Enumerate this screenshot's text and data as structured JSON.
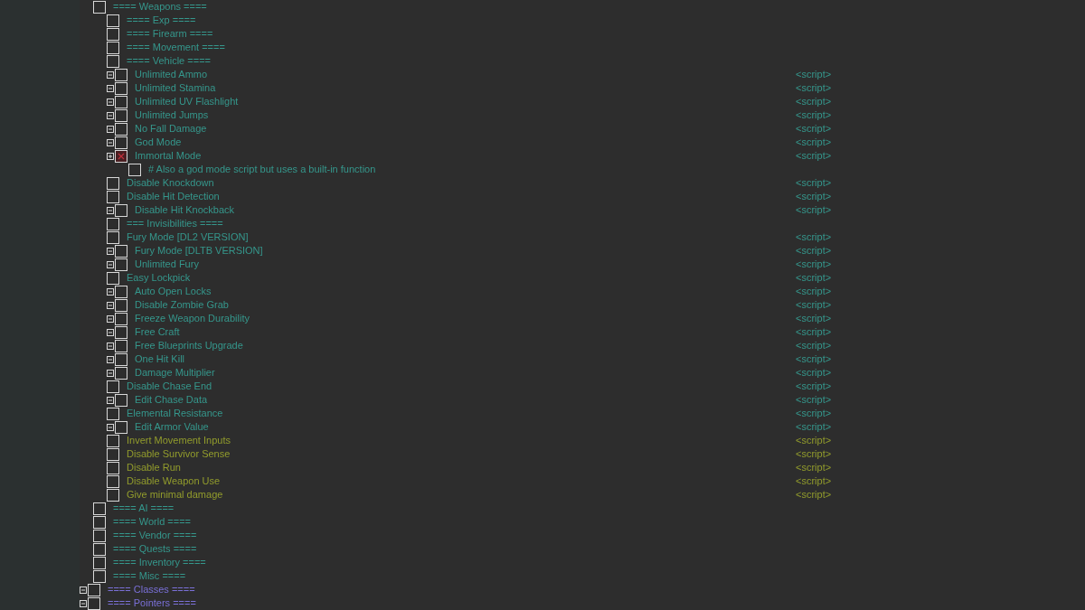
{
  "table": {
    "entries": [
      {
        "children": [
          {
            "label": "==== Weapons ====",
            "color": "#35978c",
            "checked": false,
            "children": [
              {
                "label": "==== Exp ====",
                "color": "#35978c",
                "checked": false
              },
              {
                "label": "==== Firearm ====",
                "color": "#35978c",
                "checked": false
              },
              {
                "label": "==== Movement ====",
                "color": "#35978c",
                "checked": false
              },
              {
                "label": "==== Vehicle ====",
                "color": "#35978c",
                "checked": false
              },
              {
                "label": "Unlimited Ammo",
                "color": "#35978c",
                "checked": false,
                "expanded": true,
                "value": "<script>"
              },
              {
                "label": "Unlimited Stamina",
                "color": "#35978c",
                "checked": false,
                "expanded": true,
                "value": "<script>"
              },
              {
                "label": "Unlimited UV Flashlight",
                "color": "#35978c",
                "checked": false,
                "expanded": true,
                "value": "<script>"
              },
              {
                "label": "Unlimited Jumps",
                "color": "#35978c",
                "checked": false,
                "expanded": true,
                "value": "<script>"
              },
              {
                "label": "No Fall Damage",
                "color": "#35978c",
                "checked": false,
                "expanded": true,
                "value": "<script>"
              },
              {
                "label": "God Mode",
                "color": "#35978c",
                "checked": false,
                "expanded": true,
                "value": "<script>"
              },
              {
                "label": "Immortal Mode",
                "color": "#35978c",
                "checked": true,
                "expanded": false,
                "value": "<script>",
                "children": [
                  {
                    "label": "# Also a god mode script but uses a built-in function",
                    "color": "#35978c",
                    "checked": false
                  }
                ]
              },
              {
                "label": "Disable Knockdown",
                "color": "#35978c",
                "checked": false,
                "value": "<script>"
              },
              {
                "label": "Disable Hit Detection",
                "color": "#35978c",
                "checked": false,
                "value": "<script>"
              },
              {
                "label": "Disable Hit Knockback",
                "color": "#35978c",
                "checked": false,
                "expanded": true,
                "value": "<script>"
              },
              {
                "label": "=== Invisibilities ====",
                "color": "#35978c",
                "checked": false
              },
              {
                "label": "Fury Mode [DL2 VERSION]",
                "color": "#35978c",
                "checked": false,
                "value": "<script>"
              },
              {
                "label": "Fury Mode [DLTB VERSION]",
                "color": "#35978c",
                "checked": false,
                "expanded": true,
                "value": "<script>"
              },
              {
                "label": "Unlimited Fury",
                "color": "#35978c",
                "checked": false,
                "expanded": true,
                "value": "<script>"
              },
              {
                "label": "Easy Lockpick",
                "color": "#35978c",
                "checked": false,
                "value": "<script>"
              },
              {
                "label": "Auto Open Locks",
                "color": "#35978c",
                "checked": false,
                "expanded": true,
                "value": "<script>"
              },
              {
                "label": "Disable Zombie Grab",
                "color": "#35978c",
                "checked": false,
                "expanded": true,
                "value": "<script>"
              },
              {
                "label": "Freeze Weapon Durability",
                "color": "#35978c",
                "checked": false,
                "expanded": true,
                "value": "<script>"
              },
              {
                "label": "Free Craft",
                "color": "#35978c",
                "checked": false,
                "expanded": true,
                "value": "<script>"
              },
              {
                "label": "Free Blueprints Upgrade",
                "color": "#35978c",
                "checked": false,
                "expanded": true,
                "value": "<script>"
              },
              {
                "label": "One Hit Kill",
                "color": "#35978c",
                "checked": false,
                "expanded": true,
                "value": "<script>"
              },
              {
                "label": "Damage Multiplier",
                "color": "#35978c",
                "checked": false,
                "expanded": true,
                "value": "<script>"
              },
              {
                "label": "Disable Chase End",
                "color": "#35978c",
                "checked": false,
                "value": "<script>"
              },
              {
                "label": "Edit Chase Data",
                "color": "#35978c",
                "checked": false,
                "expanded": true,
                "value": "<script>"
              },
              {
                "label": "Elemental Resistance",
                "color": "#35978c",
                "checked": false,
                "value": "<script>"
              },
              {
                "label": "Edit Armor Value",
                "color": "#35978c",
                "checked": false,
                "expanded": true,
                "value": "<script>"
              },
              {
                "label": "Invert Movement Inputs",
                "color": "#929c2c",
                "checked": false,
                "value": "<script>"
              },
              {
                "label": "Disable Survivor Sense",
                "color": "#929c2c",
                "checked": false,
                "value": "<script>"
              },
              {
                "label": "Disable Run",
                "color": "#929c2c",
                "checked": false,
                "value": "<script>"
              },
              {
                "label": "Disable Weapon Use",
                "color": "#929c2c",
                "checked": false,
                "value": "<script>"
              },
              {
                "label": "Give minimal damage",
                "color": "#929c2c",
                "checked": false,
                "value": "<script>"
              }
            ]
          },
          {
            "label": "==== AI ====",
            "color": "#35978c",
            "checked": false
          },
          {
            "label": "==== World ====",
            "color": "#35978c",
            "checked": false
          },
          {
            "label": "==== Vendor ====",
            "color": "#35978c",
            "checked": false
          },
          {
            "label": "==== Quests ====",
            "color": "#35978c",
            "checked": false
          },
          {
            "label": "==== Inventory ====",
            "color": "#35978c",
            "checked": false
          },
          {
            "label": "==== Misc ====",
            "color": "#35978c",
            "checked": false
          }
        ]
      },
      {
        "label": "==== Classes ====",
        "color": "#7a70d8",
        "checked": false,
        "expanded": true
      },
      {
        "label": "==== Pointers ====",
        "color": "#7a70d8",
        "checked": false,
        "expanded": true
      }
    ]
  }
}
